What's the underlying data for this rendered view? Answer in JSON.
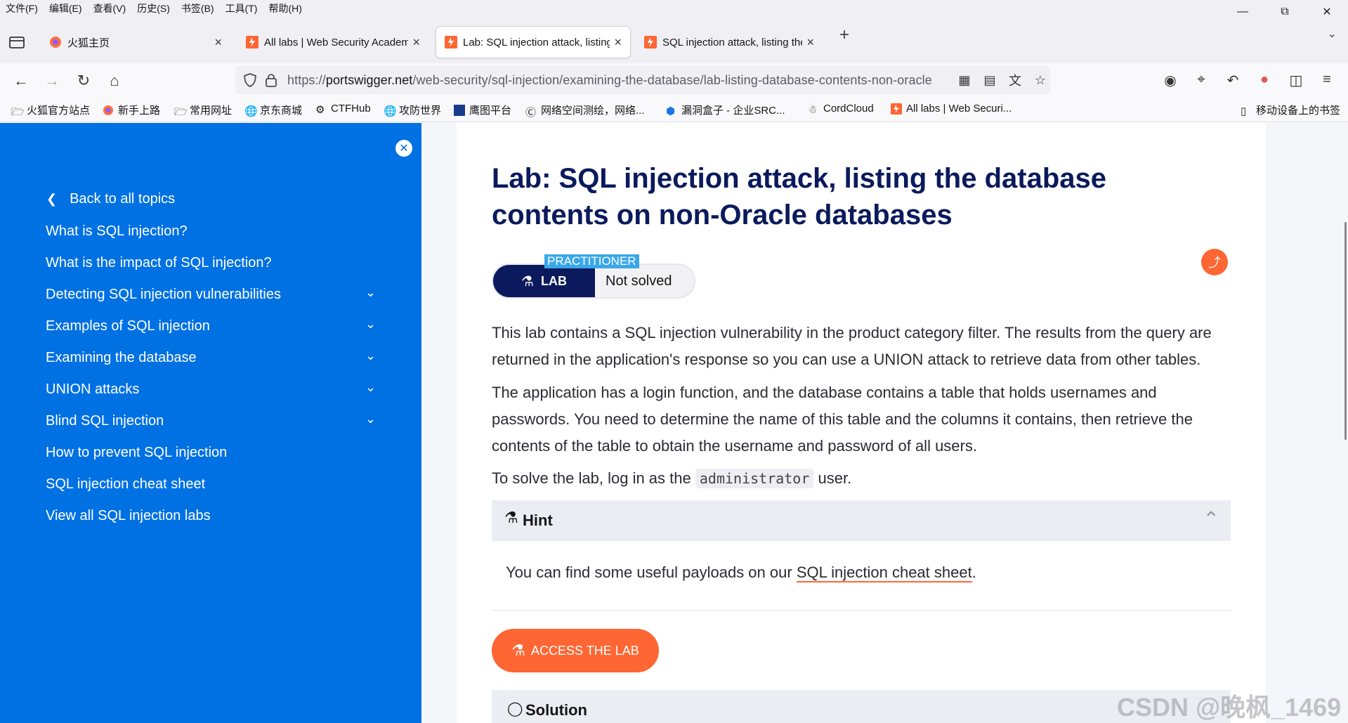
{
  "menu": [
    "文件(F)",
    "编辑(E)",
    "查看(V)",
    "历史(S)",
    "书签(B)",
    "工具(T)",
    "帮助(H)"
  ],
  "tabs": [
    {
      "title": "火狐主页",
      "favicon": "firefox-icon",
      "active": false
    },
    {
      "title": "All labs | Web Security Academy",
      "favicon": "portswigger-icon",
      "active": false
    },
    {
      "title": "Lab: SQL injection attack, listing",
      "favicon": "portswigger-icon",
      "active": true
    },
    {
      "title": "SQL injection attack, listing the",
      "favicon": "portswigger-icon",
      "active": false
    }
  ],
  "url": {
    "prefix": "https://",
    "domain": "portswigger.net",
    "path": "/web-security/sql-injection/examining-the-database/lab-listing-database-contents-non-oracle"
  },
  "bookmarks": [
    "火狐官方站点",
    "新手上路",
    "常用网址",
    "京东商城",
    "CTFHub",
    "攻防世界",
    "鹰图平台",
    "网络空间测绘，网络...",
    "漏洞盒子 - 企业SRC...",
    "CordCloud",
    "All labs | Web Securi..."
  ],
  "bookmarks_mobile": "移动设备上的书签",
  "sidebar": {
    "back": "Back to all topics",
    "items": [
      {
        "label": "What is SQL injection?",
        "expandable": false
      },
      {
        "label": "What is the impact of SQL injection?",
        "expandable": false
      },
      {
        "label": "Detecting SQL injection vulnerabilities",
        "expandable": true
      },
      {
        "label": "Examples of SQL injection",
        "expandable": true
      },
      {
        "label": "Examining the database",
        "expandable": true
      },
      {
        "label": "UNION attacks",
        "expandable": true
      },
      {
        "label": "Blind SQL injection",
        "expandable": true
      },
      {
        "label": "How to prevent SQL injection",
        "expandable": false
      },
      {
        "label": "SQL injection cheat sheet",
        "expandable": false
      },
      {
        "label": "View all SQL injection labs",
        "expandable": false
      }
    ]
  },
  "lab": {
    "title_line1": "Lab: SQL injection attack, listing the database",
    "title_line2": "contents on non-Oracle databases",
    "level": "PRACTITIONER",
    "badge": "LAB",
    "status": "Not solved",
    "p1_line1": "This lab contains a SQL injection vulnerability in the product category filter. The results from the query are",
    "p1_line2": "returned in the application's response so you can use a UNION attack to retrieve data from other tables.",
    "p2_line1": "The application has a login function, and the database contains a table that holds usernames and",
    "p2_line2": "passwords. You need to determine the name of this table and the columns it contains, then retrieve the",
    "p2_line3": "contents of the table to obtain the username and password of all users.",
    "p3_before": "To solve the lab, log in as the",
    "p3_code": "administrator",
    "p3_after": "user.",
    "hint_title": "Hint",
    "hint_before": "You can find some useful payloads on our",
    "hint_link": "SQL injection cheat sheet",
    "hint_after": ".",
    "access_button": "ACCESS THE LAB",
    "solution_title": "Solution"
  },
  "watermark": "CSDN @晚枫_1469",
  "colors": {
    "sidebar": "#0071e3",
    "title": "#0a1a5c",
    "accent": "#ff6633",
    "practitioner": "#3aa7ea"
  }
}
